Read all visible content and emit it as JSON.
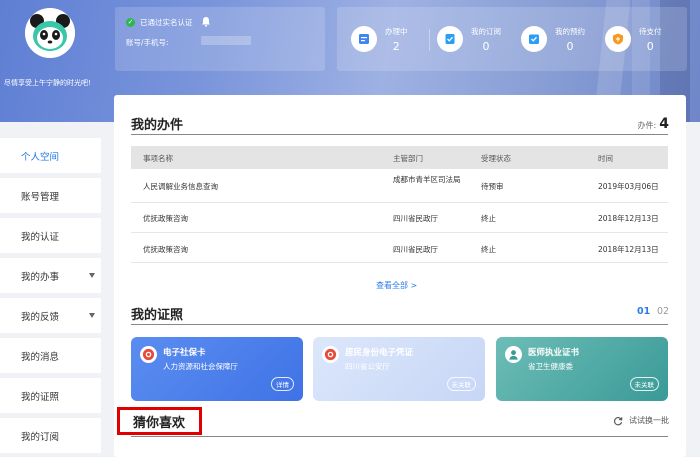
{
  "user": {
    "welcome": "尽情享受上午宁静的时光吧!",
    "verified_text": "已通过实名认证",
    "account_label": "账号/手机号:"
  },
  "stats": [
    {
      "label": "办理中",
      "value": "2",
      "icon": "form-icon"
    },
    {
      "label": "我的订阅",
      "value": "0",
      "icon": "subscribe-icon"
    },
    {
      "label": "我的预约",
      "value": "0",
      "icon": "appointment-icon"
    },
    {
      "label": "待支付",
      "value": "0",
      "icon": "payment-icon"
    }
  ],
  "sidebar": {
    "items": [
      {
        "label": "个人空间",
        "active": true,
        "has_arrow": false
      },
      {
        "label": "账号管理",
        "active": false,
        "has_arrow": false
      },
      {
        "label": "我的认证",
        "active": false,
        "has_arrow": false
      },
      {
        "label": "我的办事",
        "active": false,
        "has_arrow": true
      },
      {
        "label": "我的反馈",
        "active": false,
        "has_arrow": true
      },
      {
        "label": "我的消息",
        "active": false,
        "has_arrow": false
      },
      {
        "label": "我的证照",
        "active": false,
        "has_arrow": false
      },
      {
        "label": "我的订阅",
        "active": false,
        "has_arrow": false
      }
    ]
  },
  "affairs": {
    "title": "我的办件",
    "count_label": "办件:",
    "count": "4",
    "columns": [
      "事项名称",
      "主管部门",
      "受理状态",
      "时间"
    ],
    "rows": [
      {
        "name": "人民调解业务信息查询",
        "dept": "成都市青羊区司法局",
        "status": "待预审",
        "time": "2019年03月06日"
      },
      {
        "name": "优抚政策咨询",
        "dept": "四川省民政厅",
        "status": "终止",
        "time": "2018年12月13日"
      },
      {
        "name": "优抚政策咨询",
        "dept": "四川省民政厅",
        "status": "终止",
        "time": "2018年12月13日"
      }
    ],
    "view_all": "查看全部 >"
  },
  "certificates": {
    "title": "我的证照",
    "pages": [
      "01",
      "02"
    ],
    "active_page": "01",
    "cards": [
      {
        "title": "电子社保卡",
        "issuer": "人力资源和社会保障厅",
        "button": "详情",
        "color_start": "#5b8df0",
        "color_end": "#3f73e6"
      },
      {
        "title": "居民身份电子凭证",
        "issuer": "四川省公安厅",
        "button": "未关联",
        "color_start": "#dce7fb",
        "color_end": "#c7d6f6"
      },
      {
        "title": "医师执业证书",
        "issuer": "省卫生健康委",
        "button": "未关联",
        "color_start": "#6dbdb7",
        "color_end": "#3a9a97"
      }
    ]
  },
  "guess": {
    "title": "猜你喜欢",
    "refresh_label": "试试换一批"
  },
  "colors": {
    "accent": "#1a73e8",
    "highlight_border": "#e00000"
  }
}
